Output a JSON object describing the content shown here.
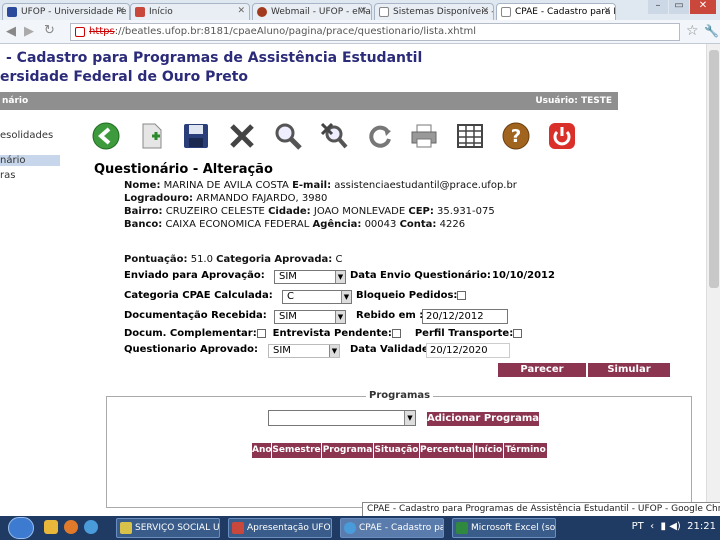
{
  "browser": {
    "tabs": [
      {
        "label": "UFOP - Universidade Fe",
        "color": "#2b4a9b"
      },
      {
        "label": "Início",
        "color": "#c9473b"
      },
      {
        "label": "Webmail - UFOP - eMa",
        "color": "#a33a1d"
      },
      {
        "label": "Sistemas Disponíveis - I",
        "color": "#8a8a8a"
      },
      {
        "label": "CPAE - Cadastro para P",
        "color": "#8a8a8a"
      }
    ],
    "url_scheme": "https",
    "url_rest": "://beatles.ufop.br:8181/cpaeAluno/pagina/prace/questionario/lista.xhtml"
  },
  "header": {
    "title": "- Cadastro para Programas de Assistência Estudantil",
    "subtitle": "ersidade Federal de Ouro Preto",
    "bar_left": "nário",
    "bar_right": "Usuário: TESTE"
  },
  "sidebar": {
    "items": [
      "esolidades",
      "nário",
      "ras"
    ]
  },
  "toolbar": {
    "icons": [
      "back-icon",
      "new-document-icon",
      "save-icon",
      "delete-icon",
      "search-icon",
      "cancel-search-icon",
      "refresh-icon",
      "print-icon",
      "grid-icon",
      "help-icon",
      "power-icon"
    ]
  },
  "form": {
    "title": "Questionário - Alteração",
    "nome_label": "Nome:",
    "nome_value": "MARINA DE AVILA COSTA",
    "email_label": "E-mail:",
    "email_value": "assistenciaestudantil@prace.ufop.br",
    "logradouro_label": "Logradouro:",
    "logradouro_value": "ARMANDO FAJARDO, 3980",
    "bairro_label": "Bairro:",
    "bairro_value": "CRUZEIRO CELESTE",
    "cidade_label": "Cidade:",
    "cidade_value": "JOAO MONLEVADE",
    "cep_label": "CEP:",
    "cep_value": "35.931-075",
    "banco_label": "Banco:",
    "banco_value": "CAIXA ECONOMICA FEDERAL",
    "agencia_label": "Agência:",
    "agencia_value": "00043",
    "conta_label": "Conta:",
    "conta_value": "4226",
    "pontuacao_label": "Pontuação:",
    "pontuacao_value": "51.0",
    "categoria_aprovada_label": "Categoria Aprovada:",
    "categoria_aprovada_value": "C",
    "enviado_label": "Enviado para Aprovação:",
    "enviado_value": "SIM",
    "data_envio_label": "Data Envio Questionário:",
    "data_envio_value": "10/10/2012",
    "categoria_calc_label": "Categoria CPAE Calculada:",
    "categoria_calc_value": "C",
    "bloqueio_label": "Bloqueio Pedidos:",
    "documentacao_label": "Documentação Recebida:",
    "documentacao_value": "SIM",
    "recebido_label": "Rebido em :",
    "recebido_value": "20/12/2012",
    "docum_comp_label": "Docum. Complementar:",
    "entrevista_label": "Entrevista Pendente:",
    "perfil_label": "Perfil Transporte:",
    "aprovado_label": "Questionario Aprovado:",
    "aprovado_value": "SIM",
    "data_validade_label": "Data Validade:",
    "data_validade_value": "20/12/2020",
    "parecer_label": "Parecer",
    "simular_label": "Simular"
  },
  "programas": {
    "legend": "Programas",
    "select_value": "",
    "add_label": "Adicionar Programa",
    "columns": [
      "Ano",
      "Semestre",
      "Programa",
      "Situação",
      "Percentual",
      "Início",
      "Término"
    ]
  },
  "status_text": "CPAE - Cadastro para Programas de Assistência Estudantil - UFOP - Google Chrome",
  "taskbar": {
    "items": [
      {
        "label": "SERVIÇO SOCIAL UF...",
        "color": "#d9c24a"
      },
      {
        "label": "Apresentação UFO...",
        "color": "#c9473b"
      },
      {
        "label": "CPAE - Cadastro par...",
        "color": "#4a9bd9"
      },
      {
        "label": "Microsoft Excel (so...",
        "color": "#2f8a3f"
      }
    ],
    "lang": "PT",
    "clock": "21:21"
  }
}
